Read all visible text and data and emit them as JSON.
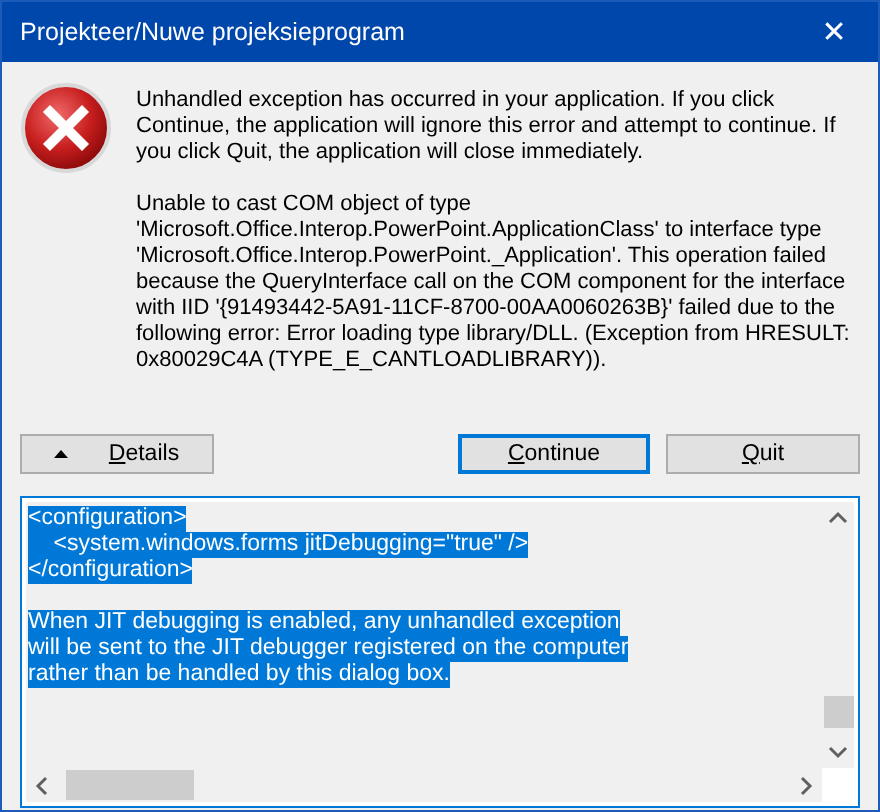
{
  "window": {
    "title": "Projekteer/Nuwe projeksieprogram",
    "close": "✕"
  },
  "message": [
    [
      "Unhandled exception has occurred in your application. If you click",
      "Continue, the application will ignore this error and attempt to continue. If",
      "you click Quit, the application will close immediately."
    ],
    [
      "Unable to cast COM object of type",
      "'Microsoft.Office.Interop.PowerPoint.ApplicationClass' to interface type",
      "'Microsoft.Office.Interop.PowerPoint._Application'. This operation failed",
      "because the QueryInterface call on the COM component for the interface",
      "with IID '{91493442-5A91-11CF-8700-00AA0060263B}' failed due to the",
      "following error: Error loading type library/DLL. (Exception from HRESULT:",
      "0x80029C4A (TYPE_E_CANTLOADLIBRARY))."
    ]
  ],
  "buttons": [
    {
      "label": "Details",
      "kind": "toggle",
      "expanded": true,
      "default": false
    },
    {
      "label": "Continue",
      "kind": "push",
      "default": true
    },
    {
      "label": "Quit",
      "kind": "push",
      "default": false
    }
  ],
  "details": {
    "paragraphs": [
      {
        "selected": true,
        "lines": [
          "<configuration>",
          "    <system.windows.forms jitDebugging=\"true\" />",
          "</configuration>"
        ]
      },
      {
        "selected": true,
        "lines": [
          "When JIT debugging is enabled, any unhandled exception",
          "will be sent to the JIT debugger registered on the computer",
          "rather than be handled by this dialog box."
        ]
      }
    ]
  }
}
